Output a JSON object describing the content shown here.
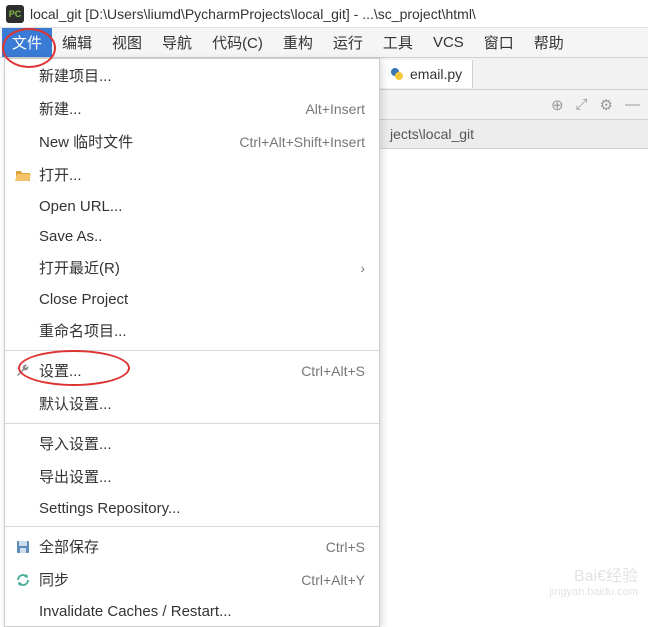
{
  "title": "local_git [D:\\Users\\liumd\\PycharmProjects\\local_git] - ...\\sc_project\\html\\",
  "menubar": {
    "file": "文件",
    "edit": "编辑",
    "view": "视图",
    "navigate": "导航",
    "code": "代码(C)",
    "refactor": "重构",
    "run": "运行",
    "tools": "工具",
    "vcs": "VCS",
    "window": "窗口",
    "help": "帮助"
  },
  "dropdown": {
    "new_project": "新建项目...",
    "new": "新建...",
    "new_shortcut": "Alt+Insert",
    "new_scratch": "New 临时文件",
    "new_scratch_shortcut": "Ctrl+Alt+Shift+Insert",
    "open": "打开...",
    "open_url": "Open URL...",
    "save_as": "Save As..",
    "open_recent": "打开最近(R)",
    "close_project": "Close Project",
    "rename_project": "重命名项目...",
    "settings": "设置...",
    "settings_shortcut": "Ctrl+Alt+S",
    "default_settings": "默认设置...",
    "import_settings": "导入设置...",
    "export_settings": "导出设置...",
    "settings_repo": "Settings Repository...",
    "save_all": "全部保存",
    "save_all_shortcut": "Ctrl+S",
    "sync": "同步",
    "sync_shortcut": "Ctrl+Alt+Y",
    "invalidate": "Invalidate Caches / Restart..."
  },
  "tabs": {
    "email": "email.py"
  },
  "breadcrumb": "jects\\local_git",
  "watermark": {
    "brand": "Bai€经验",
    "url": "jingyan.baidu.com"
  }
}
